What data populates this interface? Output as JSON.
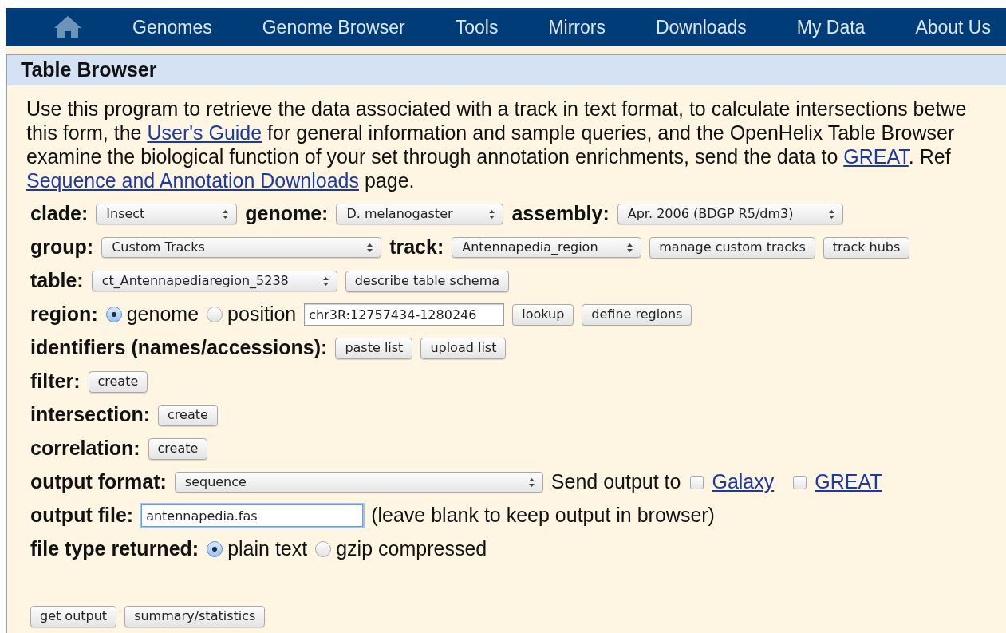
{
  "nav": {
    "items": [
      "Genomes",
      "Genome Browser",
      "Tools",
      "Mirrors",
      "Downloads",
      "My Data",
      "About Us"
    ]
  },
  "title": "Table Browser",
  "intro": {
    "lines": [
      [
        {
          "text": "Use this program to retrieve the data associated with a track in text format, to calculate intersections betwe"
        }
      ],
      [
        {
          "text": "this form, the "
        },
        {
          "text": "User's Guide",
          "link": true
        },
        {
          "text": " for general information and sample queries, and the OpenHelix Table Browser"
        }
      ],
      [
        {
          "text": "examine the biological function of your set through annotation enrichments, send the data to "
        },
        {
          "text": "GREAT",
          "link": true
        },
        {
          "text": ". Ref"
        }
      ],
      [
        {
          "text": "Sequence and Annotation Downloads",
          "link": true
        },
        {
          "text": " page."
        }
      ]
    ]
  },
  "rows": [
    [
      {
        "kind": "label",
        "text": "clade:"
      },
      {
        "kind": "select",
        "value": "Insect"
      },
      {
        "kind": "label",
        "text": "genome:"
      },
      {
        "kind": "select",
        "value": "D. melanogaster"
      },
      {
        "kind": "label",
        "text": "assembly:"
      },
      {
        "kind": "select",
        "value": "Apr. 2006 (BDGP R5/dm3)"
      }
    ],
    [
      {
        "kind": "label",
        "text": "group:"
      },
      {
        "kind": "select",
        "value": "Custom Tracks"
      },
      {
        "kind": "label",
        "text": "track:"
      },
      {
        "kind": "select",
        "value": "Antennapedia_region"
      },
      {
        "kind": "button",
        "text": "manage custom tracks"
      },
      {
        "kind": "button",
        "text": "track hubs"
      }
    ],
    [
      {
        "kind": "label",
        "text": "table:"
      },
      {
        "kind": "select",
        "value": "ct_Antennapediaregion_5238"
      },
      {
        "kind": "button",
        "text": "describe table schema"
      }
    ],
    [
      {
        "kind": "label",
        "text": "region:"
      },
      {
        "kind": "radio",
        "text": "genome",
        "selected": true
      },
      {
        "kind": "radio",
        "text": "position",
        "selected": false
      },
      {
        "kind": "input",
        "value": "chr3R:12757434-1280246",
        "focused": false
      },
      {
        "kind": "button",
        "text": "lookup"
      },
      {
        "kind": "button",
        "text": "define regions"
      }
    ],
    [
      {
        "kind": "label",
        "text": "identifiers (names/accessions):"
      },
      {
        "kind": "button",
        "text": "paste list"
      },
      {
        "kind": "button",
        "text": "upload list"
      }
    ],
    [
      {
        "kind": "label",
        "text": "filter:"
      },
      {
        "kind": "button",
        "text": "create"
      }
    ],
    [
      {
        "kind": "label",
        "text": "intersection:"
      },
      {
        "kind": "button",
        "text": "create"
      }
    ],
    [
      {
        "kind": "label",
        "text": "correlation:"
      },
      {
        "kind": "button",
        "text": "create"
      }
    ],
    [
      {
        "kind": "label",
        "text": "output format:"
      },
      {
        "kind": "select",
        "value": "sequence"
      },
      {
        "kind": "text",
        "text": "Send output to"
      },
      {
        "kind": "checkbox",
        "text": "Galaxy",
        "checked": false
      },
      {
        "kind": "checkbox",
        "text": "GREAT",
        "checked": false
      }
    ],
    [
      {
        "kind": "label",
        "text": "output file:"
      },
      {
        "kind": "input",
        "value": "antennapedia.fas",
        "focused": true
      },
      {
        "kind": "text",
        "text": "(leave blank to keep output in browser)"
      }
    ],
    [
      {
        "kind": "label",
        "text": "file type returned:"
      },
      {
        "kind": "radio",
        "text": "plain text",
        "selected": true
      },
      {
        "kind": "radio",
        "text": "gzip compressed",
        "selected": false
      }
    ],
    [
      {
        "kind": "spacer"
      }
    ],
    [
      {
        "kind": "button",
        "text": "get output"
      },
      {
        "kind": "button",
        "text": "summary/statistics"
      }
    ]
  ]
}
